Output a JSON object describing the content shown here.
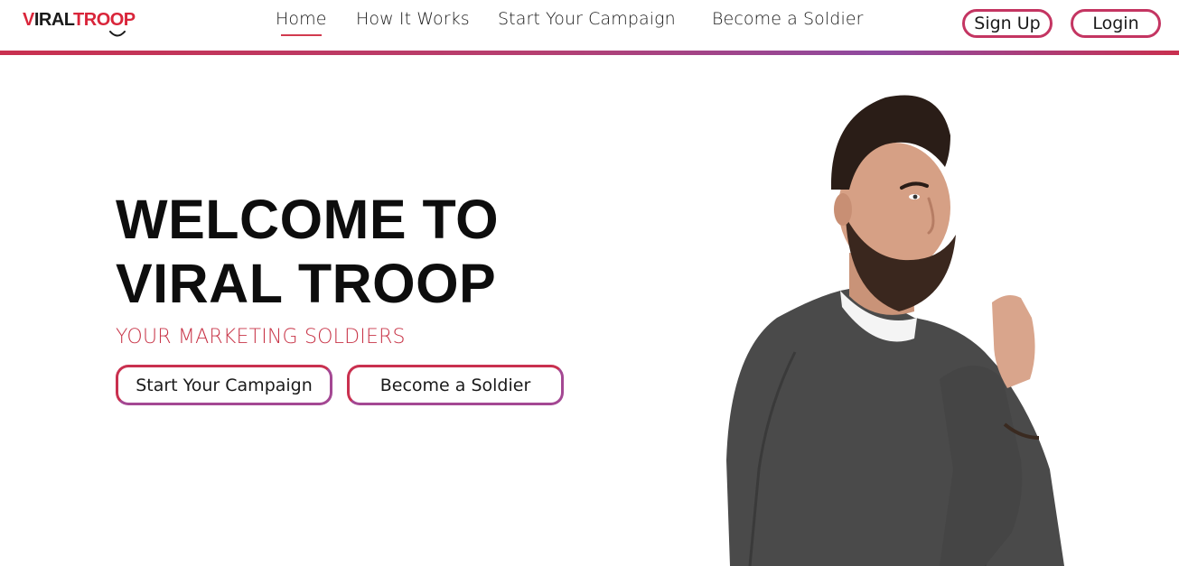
{
  "brand": {
    "logo_v": "V",
    "logo_iral": "IRAL",
    "logo_troop": "TROOP",
    "accent_color": "#d9253a",
    "border_gradient": [
      "#c9304f",
      "#8e4aa0"
    ]
  },
  "nav": {
    "links": [
      {
        "label": "Home",
        "active": true
      },
      {
        "label": "How It Works",
        "active": false
      },
      {
        "label": "Start Your Campaign",
        "active": false
      },
      {
        "label": "Become a Soldier",
        "active": false
      }
    ],
    "signup_label": "Sign Up",
    "login_label": "Login"
  },
  "hero": {
    "title_line1": "WELCOME TO",
    "title_line2": "VIRAL TROOP",
    "subtitle": "YOUR MARKETING SOLDIERS",
    "cta_primary": "Start Your Campaign",
    "cta_secondary": "Become a Soldier"
  },
  "illustration": {
    "icon": "bearded-man-photo-icon"
  }
}
